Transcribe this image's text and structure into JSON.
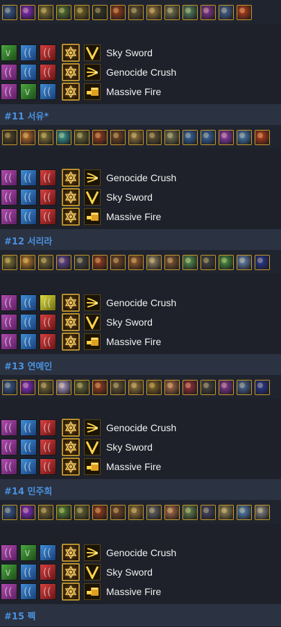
{
  "colors": {
    "label": "#4a92e0",
    "label_strip": "#2b3241",
    "background": "#1e212a"
  },
  "icon_names": {
    "rune": "rune-icon",
    "stat": "hexagram-stat-icon",
    "sky_sword": "sky-sword-icon",
    "genocide_crush": "genocide-crush-icon",
    "massive_fire": "massive-fire-icon"
  },
  "builds": [
    {
      "label": "#11 서유*",
      "items": [
        "#3a5d9a",
        "#8c2fd0",
        "#8a7a3a",
        "#5a7a3a",
        "#7a6a2a",
        "#3a3a2a",
        "#a04020",
        "#6a5a3a",
        "#9a7a40",
        "#7a7a5a",
        "#5a8a6a",
        "#8a3aa0",
        "#4a6aa0",
        "#c04020"
      ],
      "rows": [
        {
          "runes": [
            "green",
            "blue",
            "red"
          ],
          "skill": "sky_sword",
          "name": "Sky Sword"
        },
        {
          "runes": [
            "purple",
            "blue",
            "red"
          ],
          "skill": "genocide_crush",
          "name": "Genocide Crush"
        },
        {
          "runes": [
            "purple",
            "green",
            "blue"
          ],
          "skill": "massive_fire",
          "name": "Massive Fire"
        }
      ]
    },
    {
      "label": "#12 서리라",
      "items": [
        "#5a4a2a",
        "#c07030",
        "#8a7a3a",
        "#3aa0a0",
        "#6a6a3a",
        "#a04020",
        "#7a4a2a",
        "#9a7a40",
        "#6a5a3a",
        "#7a7a5a",
        "#3a6ab0",
        "#3a6ab0",
        "#9a40c0",
        "#4a80c0",
        "#c04020"
      ],
      "rows": [
        {
          "runes": [
            "purple",
            "blue",
            "red"
          ],
          "skill": "genocide_crush",
          "name": "Genocide Crush"
        },
        {
          "runes": [
            "purple",
            "blue",
            "red"
          ],
          "skill": "sky_sword",
          "name": "Sky Sword"
        },
        {
          "runes": [
            "purple",
            "blue",
            "red"
          ],
          "skill": "massive_fire",
          "name": "Massive Fire"
        }
      ]
    },
    {
      "label": "#13 연예인",
      "items": [
        "#8a7a3a",
        "#c08030",
        "#7a6a3a",
        "#6a4aa0",
        "#4a4a4a",
        "#a04020",
        "#7a4a2a",
        "#a06030",
        "#9a8a6a",
        "#8a5a3a",
        "#5a9a5a",
        "#4a4a4a",
        "#4a9a4a",
        "#6a8ac0",
        "#2a3aa0"
      ],
      "rows": [
        {
          "runes": [
            "purple",
            "blue",
            "yellow"
          ],
          "skill": "genocide_crush",
          "name": "Genocide Crush"
        },
        {
          "runes": [
            "purple",
            "blue",
            "red"
          ],
          "skill": "sky_sword",
          "name": "Sky Sword"
        },
        {
          "runes": [
            "purple",
            "blue",
            "red"
          ],
          "skill": "massive_fire",
          "name": "Massive Fire"
        }
      ]
    },
    {
      "label": "#14 민주희",
      "items": [
        "#3a5d9a",
        "#8c2fd0",
        "#7a6a3a",
        "#b0a0d0",
        "#6a6a3a",
        "#a04020",
        "#6a5a3a",
        "#9a7a40",
        "#8a6a2a",
        "#b07050",
        "#a03040",
        "#4a4a4a",
        "#8a3aa0",
        "#4a6aa0",
        "#2a3aa0"
      ],
      "rows": [
        {
          "runes": [
            "purple",
            "blue",
            "red"
          ],
          "skill": "genocide_crush",
          "name": "Genocide Crush"
        },
        {
          "runes": [
            "purple",
            "blue",
            "red"
          ],
          "skill": "sky_sword",
          "name": "Sky Sword"
        },
        {
          "runes": [
            "purple",
            "blue",
            "red"
          ],
          "skill": "massive_fire",
          "name": "Massive Fire"
        }
      ]
    },
    {
      "label": "#15 펙",
      "items": [
        "#3a5d9a",
        "#8c2fd0",
        "#7a6a3a",
        "#5a8a3a",
        "#6a6a3a",
        "#a04020",
        "#7a4a2a",
        "#9a7a40",
        "#6a6a6a",
        "#b07050",
        "#6a8a5a",
        "#4a4a6a",
        "#9a8a5a",
        "#5a8ac0",
        "#8a8a8a"
      ],
      "rows": [
        {
          "runes": [
            "purple",
            "green",
            "blue"
          ],
          "skill": "genocide_crush",
          "name": "Genocide Crush"
        },
        {
          "runes": [
            "green",
            "blue",
            "red"
          ],
          "skill": "sky_sword",
          "name": "Sky Sword"
        },
        {
          "runes": [
            "purple",
            "blue",
            "red"
          ],
          "skill": "massive_fire",
          "name": "Massive Fire"
        }
      ]
    }
  ]
}
